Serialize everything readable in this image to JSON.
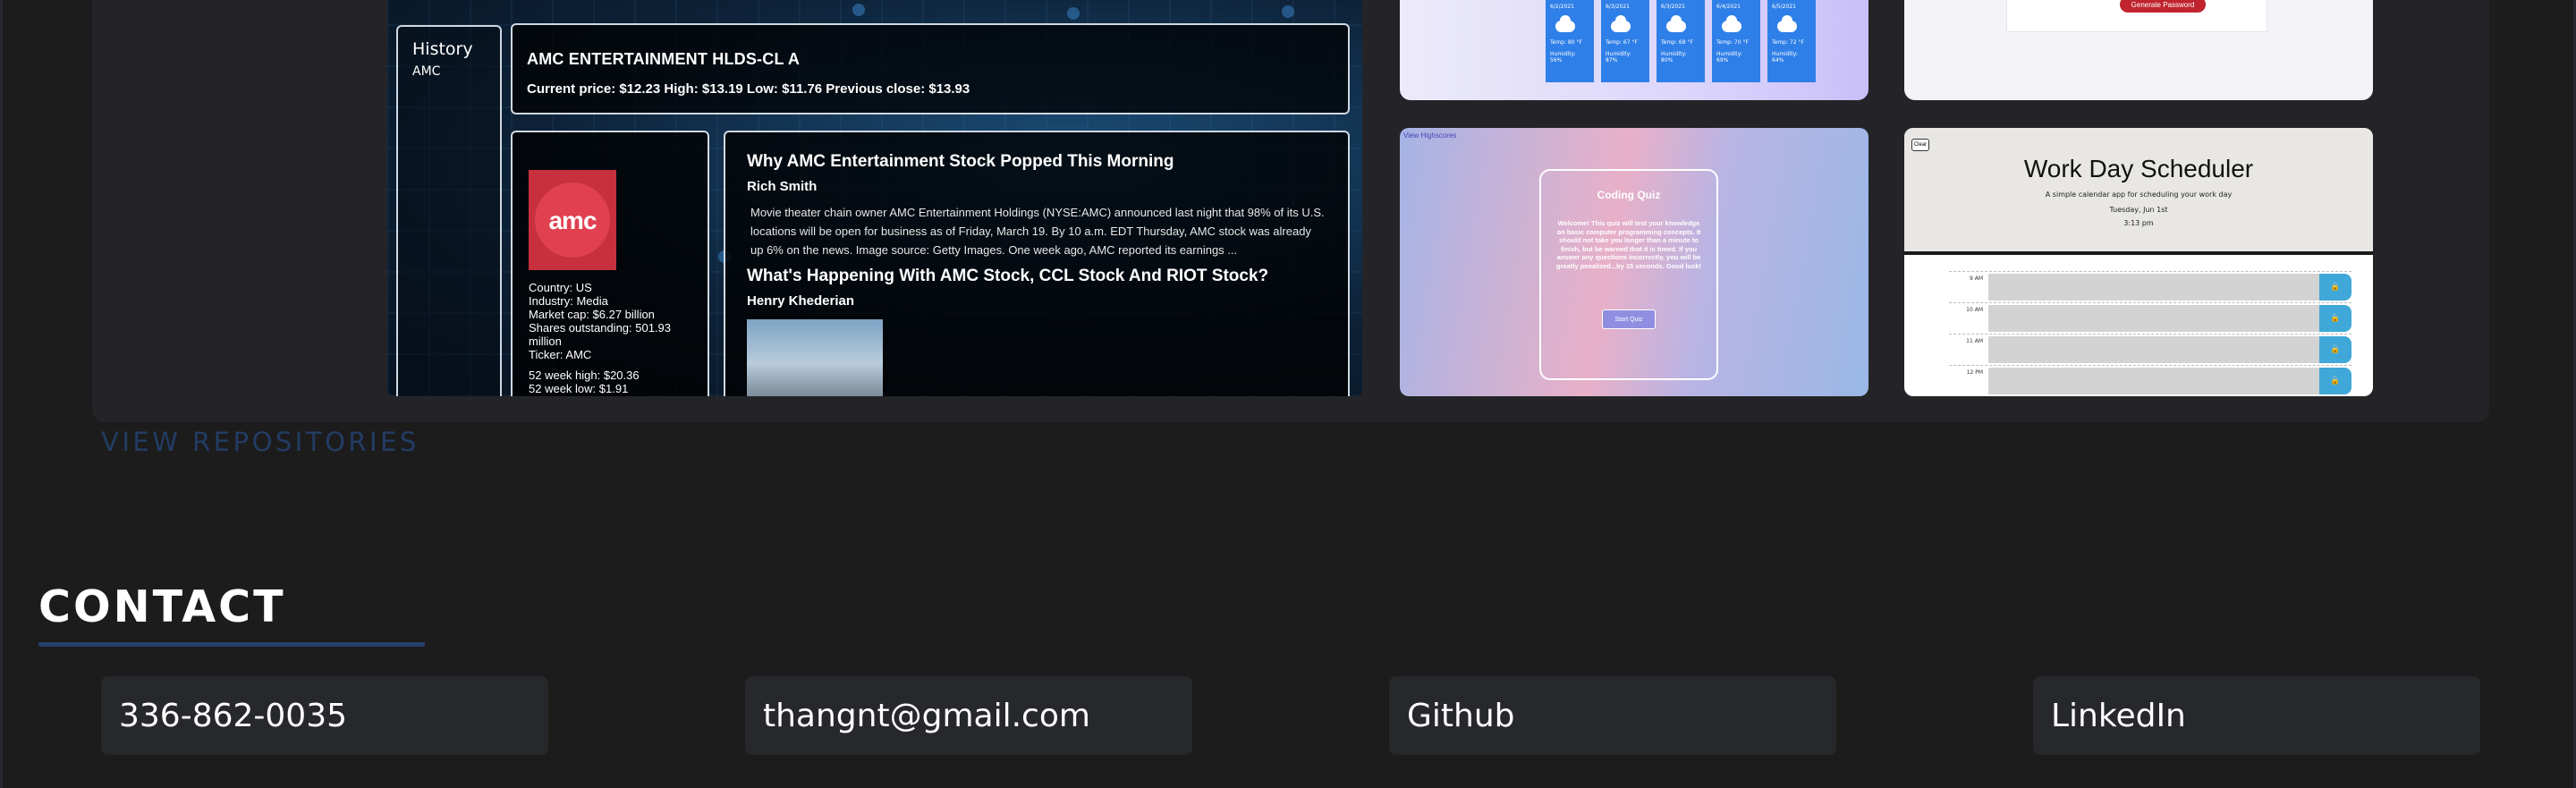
{
  "stock_app": {
    "history_title": "History",
    "history_item": "AMC",
    "company_name": "AMC ENTERTAINMENT HLDS-CL A",
    "price_line": "Current price: $12.23 High: $13.19 Low: $11.76 Previous close: $13.93",
    "logo_text": "amc",
    "profile": {
      "country": "Country: US",
      "industry": "Industry: Media",
      "market_cap": "Market cap: $6.27 billion",
      "shares_1": "Shares outstanding: 501.93",
      "shares_2": "million",
      "ticker": "Ticker: AMC",
      "high52": "52 week high: $20.36",
      "low52": "52 week low: $1.91"
    },
    "news": [
      {
        "title": "Why AMC Entertainment Stock Popped This Morning",
        "author": "Rich Smith",
        "summary": "Movie theater chain owner AMC Entertainment Holdings (NYSE:AMC) announced last night that 98% of its U.S. locations will be open for business as of Friday, March 19. By 10 a.m. EDT Thursday, AMC stock was already up 6% on the news. Image source: Getty Images. One week ago, AMC reported its earnings ..."
      },
      {
        "title": "What's Happening With AMC Stock, CCL Stock And RIOT Stock?",
        "author": "Henry Khederian"
      }
    ]
  },
  "weather_app": {
    "days": [
      {
        "date": "6/2/2021",
        "temp": "Temp: 80 °F",
        "humidity": "Humidity: 56%"
      },
      {
        "date": "6/3/2021",
        "temp": "Temp: 67 °F",
        "humidity": "Humidity: 87%"
      },
      {
        "date": "6/3/2021",
        "temp": "Temp: 68 °F",
        "humidity": "Humidity: 80%"
      },
      {
        "date": "6/4/2021",
        "temp": "Temp: 70 °F",
        "humidity": "Humidity: 69%"
      },
      {
        "date": "6/5/2021",
        "temp": "Temp: 72 °F",
        "humidity": "Humidity: 64%"
      }
    ]
  },
  "password_app": {
    "button_label": "Generate Password"
  },
  "quiz_app": {
    "highscores_link": "View Highscores",
    "title": "Coding Quiz",
    "intro": "Welcome! This quiz will test your knowledge on basic computer programming concepts. It should not take you longer than a minute to finish, but be warned that it is timed. If you answer any questions incorrectly, you will be greatly penalized...by 15 seconds. Good luck!",
    "start_label": "Start Quiz"
  },
  "scheduler_app": {
    "clear_label": "Clear",
    "title": "Work Day Scheduler",
    "subtitle": "A simple calendar app for scheduling your work day",
    "date": "Tuesday, Jun 1st",
    "time": "3:13 pm",
    "hours": [
      "9 AM",
      "10 AM",
      "11 AM",
      "12 PM"
    ]
  },
  "view_repos_label": "VIEW REPOSITORIES",
  "contact": {
    "heading": "CONTACT",
    "items": [
      {
        "label": "336-862-0035"
      },
      {
        "label": "thangnt@gmail.com"
      },
      {
        "label": "Github"
      },
      {
        "label": "LinkedIn"
      }
    ]
  }
}
